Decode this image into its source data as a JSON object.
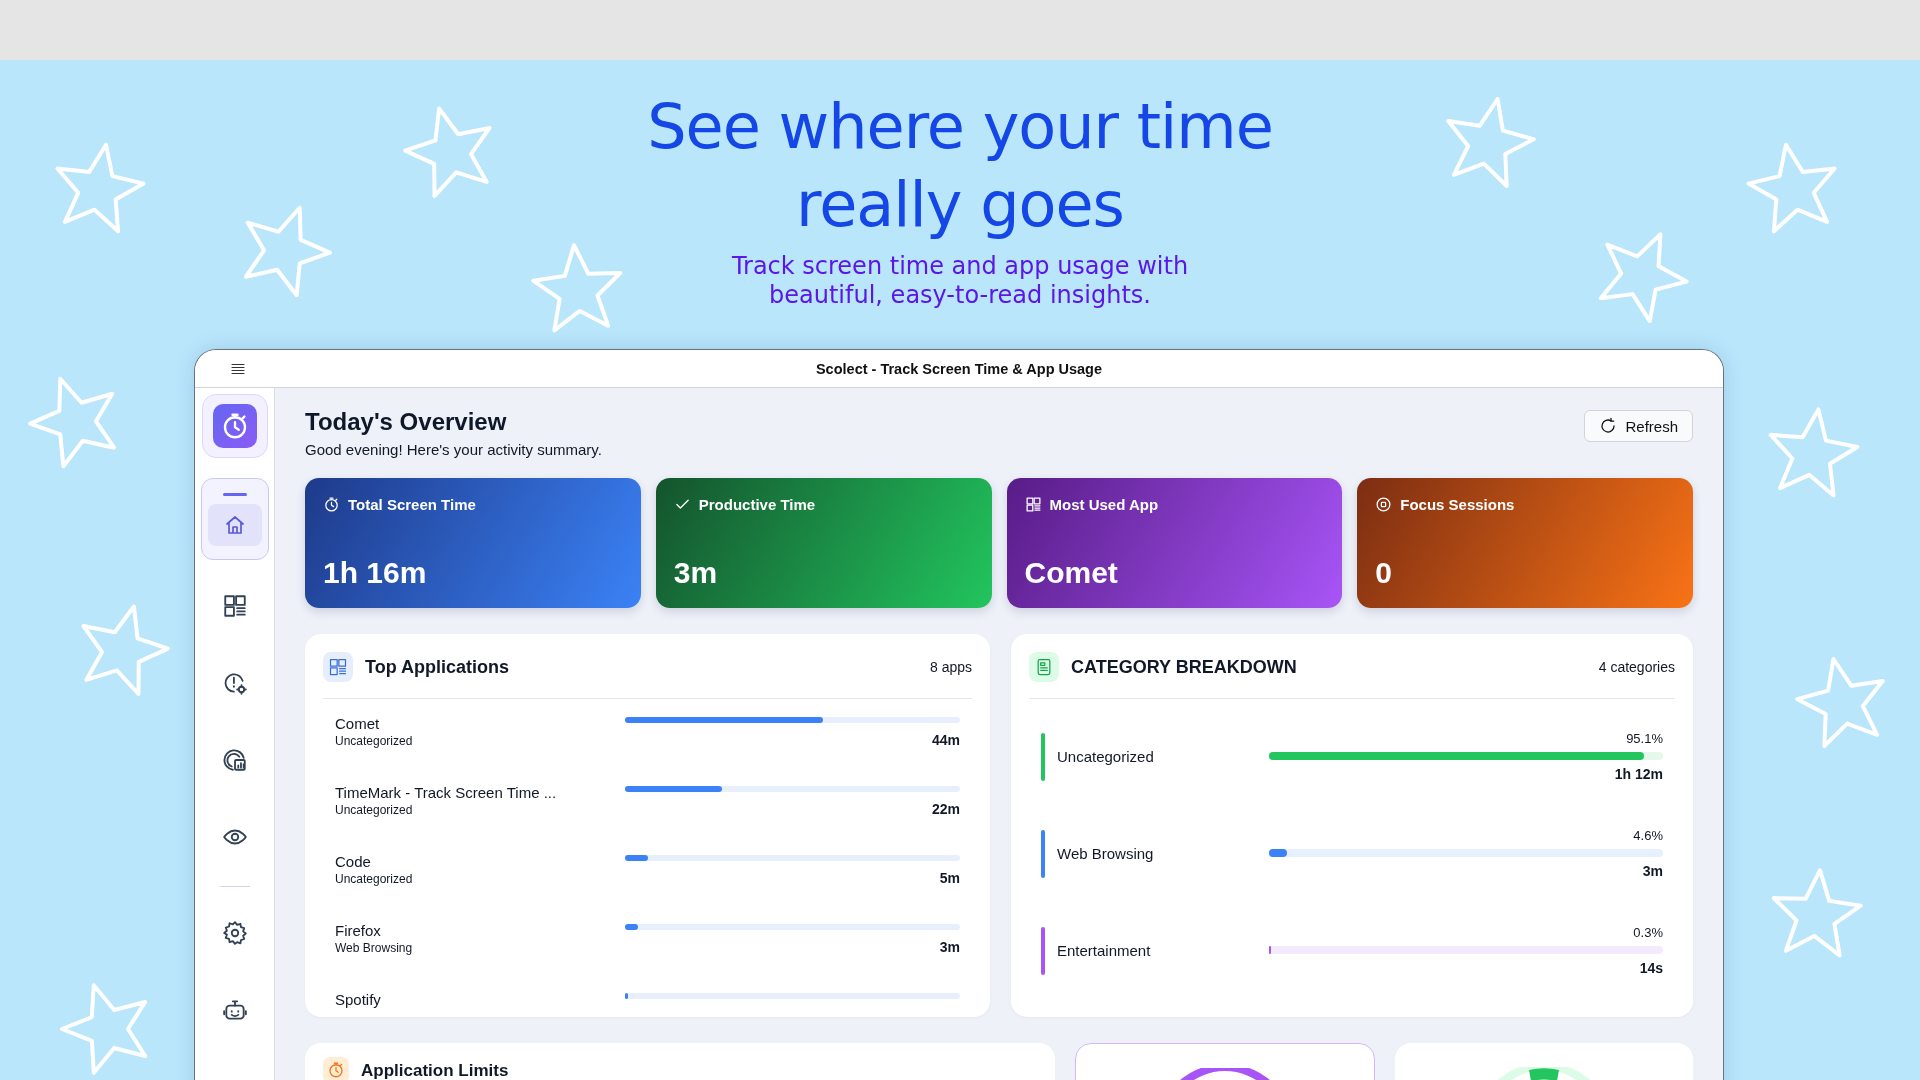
{
  "hero": {
    "title": "See where your time really goes",
    "subtitle": "Track screen time and app usage with beautiful, easy-to-read insights."
  },
  "window": {
    "title": "Scolect - Track Screen Time & App Usage"
  },
  "sidebar": {
    "items": [
      {
        "kind": "home",
        "selected": true
      },
      {
        "kind": "apps",
        "selected": false
      },
      {
        "kind": "limits",
        "selected": false
      },
      {
        "kind": "reports",
        "selected": false
      },
      {
        "kind": "focus",
        "selected": false
      }
    ],
    "footer_items": [
      {
        "kind": "settings",
        "selected": false
      },
      {
        "kind": "assistant",
        "selected": false
      }
    ]
  },
  "overview": {
    "title": "Today's Overview",
    "subtitle": "Good evening! Here's your activity summary.",
    "refresh": "Refresh"
  },
  "stats": [
    {
      "kind": "time",
      "label": "Total Screen Time",
      "value": "1h 16m"
    },
    {
      "kind": "productive",
      "label": "Productive Time",
      "value": "3m"
    },
    {
      "kind": "app",
      "label": "Most Used App",
      "value": "Comet"
    },
    {
      "kind": "focus",
      "label": "Focus Sessions",
      "value": "0"
    }
  ],
  "top_apps": {
    "title": "Top Applications",
    "count": "8 apps",
    "rows": [
      {
        "name": "Comet",
        "category": "Uncategorized",
        "level": 0.59,
        "duration": "44m"
      },
      {
        "name": "TimeMark - Track Screen Time ...",
        "category": "Uncategorized",
        "level": 0.29,
        "duration": "22m"
      },
      {
        "name": "Code",
        "category": "Uncategorized",
        "level": 0.07,
        "duration": "5m"
      },
      {
        "name": "Firefox",
        "category": "Web Browsing",
        "level": 0.04,
        "duration": "3m"
      },
      {
        "name": "Spotify",
        "level": 0.006
      }
    ]
  },
  "categories": {
    "title": "CATEGORY BREAKDOWN",
    "count": "4 categories",
    "rows": [
      {
        "name": "Uncategorized",
        "percent": "95.1%",
        "duration": "1h 12m",
        "level": 0.951,
        "color": "#22c55e"
      },
      {
        "name": "Web Browsing",
        "percent": "4.6%",
        "duration": "3m",
        "level": 0.046,
        "color": "#3b82f6"
      },
      {
        "name": "Entertainment",
        "percent": "0.3%",
        "duration": "14s",
        "level": 0.003,
        "color": "#a855f7"
      }
    ]
  },
  "limits": {
    "title": "Application Limits"
  }
}
